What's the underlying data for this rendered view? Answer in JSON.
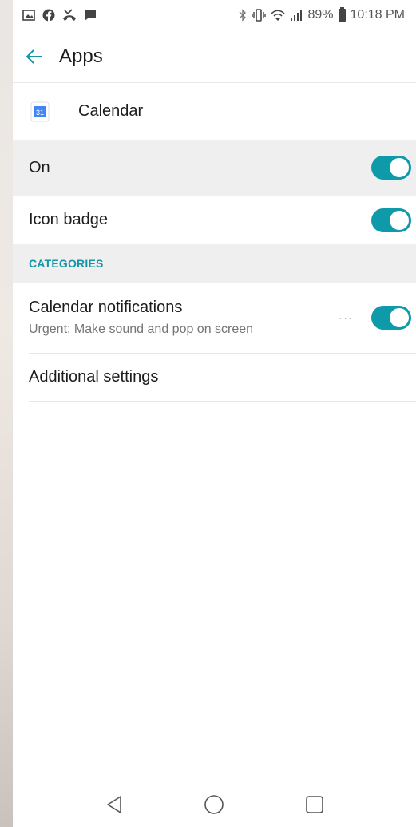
{
  "status_bar": {
    "left_icons": [
      "image-icon",
      "facebook-icon",
      "missed-call-icon",
      "chat-icon"
    ],
    "right_icons": [
      "bluetooth-icon",
      "vibrate-icon",
      "wifi-icon",
      "signal-icon"
    ],
    "battery": "89%",
    "time": "10:18 PM"
  },
  "app_bar": {
    "back_icon": "back-arrow-icon",
    "title": "Apps"
  },
  "app_header": {
    "icon": "calendar-app-icon",
    "icon_day": "31",
    "name": "Calendar"
  },
  "settings": {
    "on": {
      "label": "On",
      "enabled": true
    },
    "icon_badge": {
      "label": "Icon badge",
      "enabled": true
    }
  },
  "categories": {
    "header": "CATEGORIES",
    "items": [
      {
        "title": "Calendar notifications",
        "subtitle": "Urgent: Make sound and pop on screen",
        "more": "···",
        "enabled": true
      }
    ]
  },
  "additional_settings": "Additional settings",
  "nav_bar": [
    "back-icon",
    "home-icon",
    "recents-icon"
  ],
  "colors": {
    "accent": "#0f9aaa",
    "section_header_text": "#1296a8",
    "highlight_row_bg": "#efefef"
  }
}
